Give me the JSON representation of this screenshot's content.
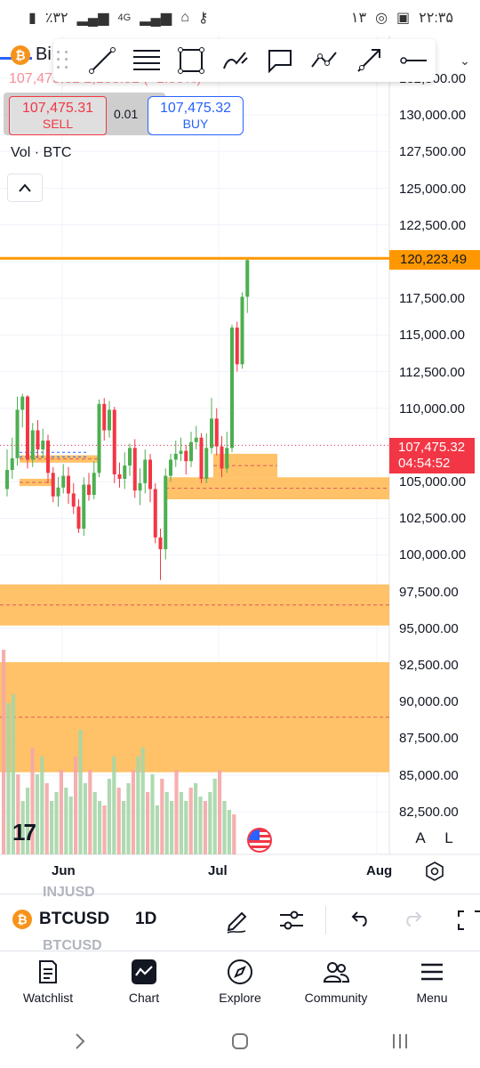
{
  "status_bar": {
    "left_text": "٪۳۲",
    "network": "4G",
    "right_text": "۱۳",
    "time": "۲۲:۳۵"
  },
  "draw_toolbar": {
    "tools": [
      "trend-line",
      "horizontal-lines",
      "rectangle",
      "brush",
      "comment",
      "path",
      "arrow-line",
      "horizontal-ray"
    ]
  },
  "symbol": {
    "short_name": "Bi",
    "faded_line": "107,475.32   2,183.01 (+1.90%)"
  },
  "trade": {
    "sell_price": "107,475.31",
    "sell_label": "SELL",
    "quantity": "0.01",
    "buy_price": "107,475.32",
    "buy_label": "BUY"
  },
  "volume_label": "Vol · BTC",
  "price_axis": {
    "labels": [
      "132,500.00",
      "130,000.00",
      "127,500.00",
      "125,000.00",
      "122,500.00",
      "117,500.00",
      "115,000.00",
      "112,500.00",
      "110,000.00",
      "105,000.00",
      "102,500.00",
      "100,000.00",
      "97,500.00",
      "95,000.00",
      "92,500.00",
      "90,000.00",
      "87,500.00",
      "85,000.00",
      "82,500.00"
    ],
    "orange_line_price": "120,223.49",
    "last_price": "107,475.32",
    "countdown": "04:54:52"
  },
  "time_axis": {
    "labels": [
      "Jun",
      "Jul",
      "Aug"
    ]
  },
  "chart_data": {
    "type": "candlestick",
    "interval": "1D",
    "ylim": [
      81500,
      133000
    ],
    "horizontal_line": 120223.49,
    "last_price": 107475.32,
    "zones": [
      {
        "from": 95000,
        "to": 97500
      },
      {
        "from": 85000,
        "to": 92500
      },
      {
        "from": 103800,
        "to": 105200
      }
    ]
  },
  "scale_buttons": {
    "auto": "A",
    "log": "L"
  },
  "logo_text": "17",
  "bottom_bar": {
    "symbol": "BTCUSD",
    "ghost_above": "INJUSD",
    "ghost_below": "BTCUSD",
    "interval": "1D"
  },
  "nav": {
    "items": [
      {
        "label": "Watchlist",
        "icon": "watchlist-icon"
      },
      {
        "label": "Chart",
        "icon": "chart-icon"
      },
      {
        "label": "Explore",
        "icon": "compass-icon"
      },
      {
        "label": "Community",
        "icon": "community-icon"
      },
      {
        "label": "Menu",
        "icon": "menu-icon"
      }
    ]
  },
  "colors": {
    "up": "#4caf50",
    "down": "#f23645",
    "zone": "#ffb74d",
    "orange_line": "#ff9800",
    "buy": "#2962ff"
  }
}
